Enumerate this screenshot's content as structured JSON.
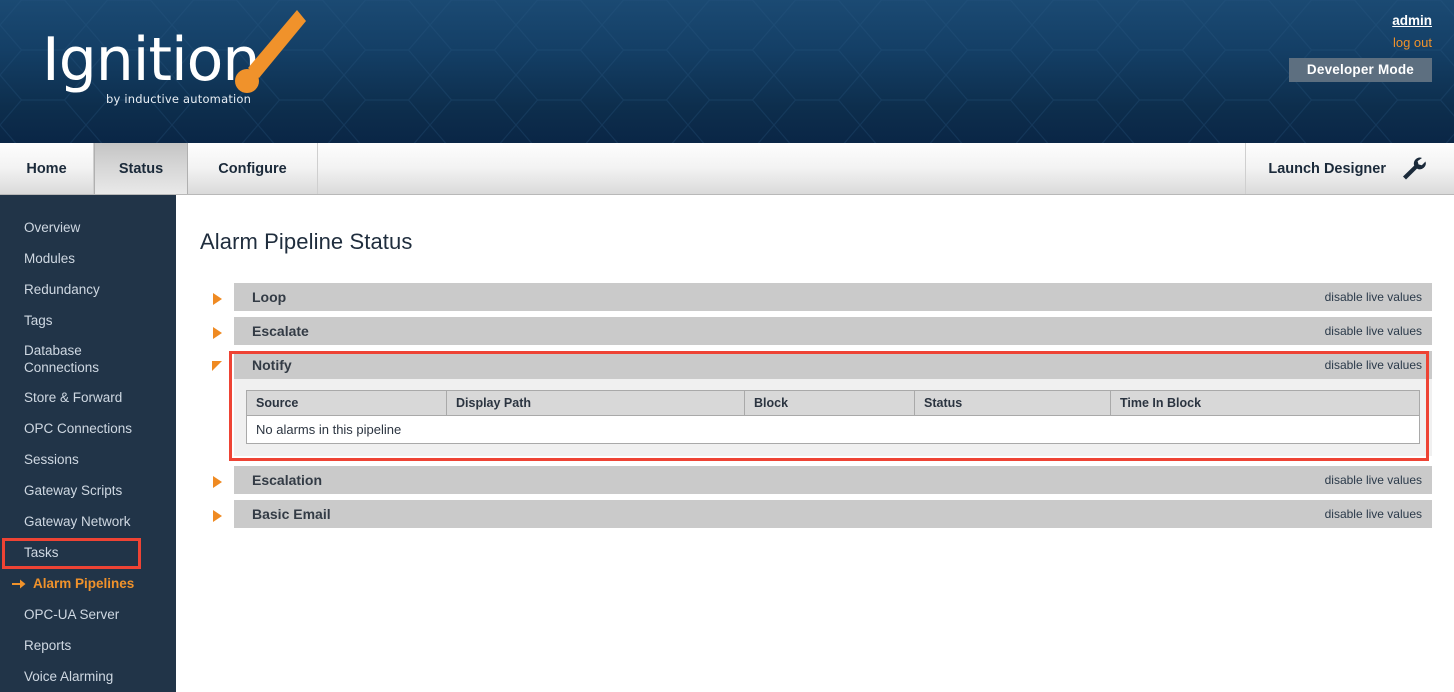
{
  "header": {
    "logo_text": "Ignition",
    "logo_subtitle": "by inductive automation",
    "user": "admin",
    "logout": "log out",
    "dev_mode": "Developer Mode",
    "accent_orange": "#f0922b",
    "bg_navy": "#0d2e4d"
  },
  "nav": {
    "tabs": [
      {
        "label": "Home",
        "active": false
      },
      {
        "label": "Status",
        "active": true
      },
      {
        "label": "Configure",
        "active": false
      }
    ],
    "launch_label": "Launch Designer",
    "launch_icon": "wrench-icon"
  },
  "sidebar": {
    "items": [
      {
        "label": "Overview"
      },
      {
        "label": "Modules"
      },
      {
        "label": "Redundancy"
      },
      {
        "label": "Tags"
      },
      {
        "label": "Database Connections"
      },
      {
        "label": "Store & Forward"
      },
      {
        "label": "OPC Connections"
      },
      {
        "label": "Sessions"
      },
      {
        "label": "Gateway Scripts"
      },
      {
        "label": "Gateway Network"
      },
      {
        "label": "Tasks"
      },
      {
        "label": "Alarm Pipelines"
      },
      {
        "label": "OPC-UA Server"
      },
      {
        "label": "Reports"
      },
      {
        "label": "Voice Alarming"
      }
    ],
    "active_label": "Alarm Pipelines",
    "active_icon": "arrow-right-icon",
    "highlight_color": "#ee4334"
  },
  "main": {
    "title": "Alarm Pipeline Status",
    "live_values_link": "disable live values",
    "pipelines": [
      {
        "name": "Loop",
        "expanded": false
      },
      {
        "name": "Escalate",
        "expanded": false
      },
      {
        "name": "Notify",
        "expanded": true
      },
      {
        "name": "Escalation",
        "expanded": false
      },
      {
        "name": "Basic Email",
        "expanded": false
      }
    ],
    "table": {
      "columns": [
        "Source",
        "Display Path",
        "Block",
        "Status",
        "Time In Block"
      ],
      "empty_message": "No alarms in this pipeline",
      "rows": []
    }
  }
}
